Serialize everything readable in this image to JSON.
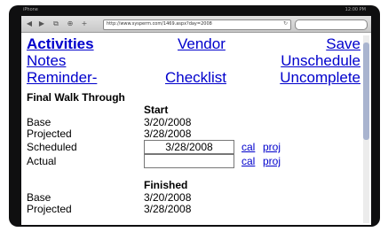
{
  "status": {
    "carrier": "iPhone",
    "time": "12:00 PM"
  },
  "browser": {
    "back": "◀",
    "forward": "▶",
    "bookmarks": "⧉",
    "tabs": "⊕",
    "add": "+",
    "url": "http://www.sysperm.com/1469.aspx?day=2008",
    "reload": "↻"
  },
  "nav": {
    "activities": "Activities",
    "vendor": "Vendor",
    "save": "Save",
    "notes": "Notes",
    "unschedule": "Unschedule",
    "reminder": "Reminder-",
    "checklist": "Checklist",
    "uncomplete": "Uncomplete"
  },
  "section": {
    "title": "Final Walk Through",
    "start": {
      "heading": "Start",
      "base_label": "Base",
      "base_value": "3/20/2008",
      "projected_label": "Projected",
      "projected_value": "3/28/2008",
      "scheduled_label": "Scheduled",
      "scheduled_value": "3/28/2008",
      "actual_label": "Actual",
      "actual_value": "",
      "cal_link": "cal",
      "proj_link": "proj"
    },
    "finished": {
      "heading": "Finished",
      "base_label": "Base",
      "base_value": "3/20/2008",
      "projected_label": "Projected",
      "projected_value": "3/28/2008"
    }
  }
}
